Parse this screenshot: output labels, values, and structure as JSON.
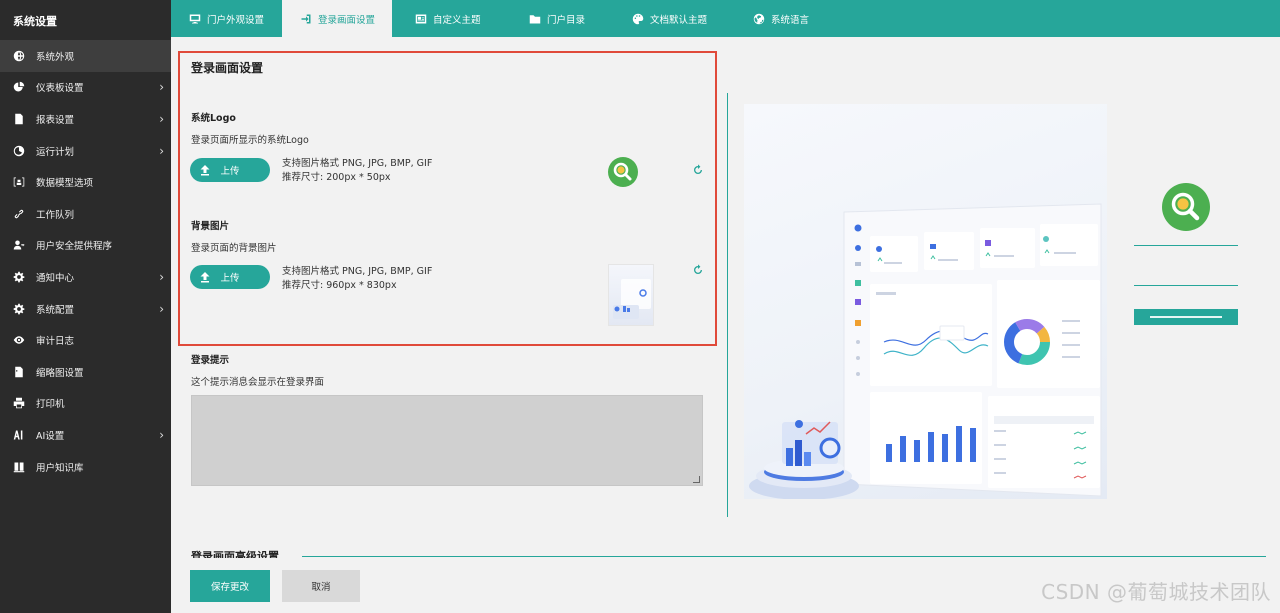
{
  "sidebar": {
    "title": "系统设置",
    "items": [
      {
        "label": "系统外观",
        "icon": "globe-icon",
        "active": true,
        "chevron": false
      },
      {
        "label": "仪表板设置",
        "icon": "pie-chart-icon",
        "chevron": true
      },
      {
        "label": "报表设置",
        "icon": "report-icon",
        "chevron": true
      },
      {
        "label": "运行计划",
        "icon": "clock-icon",
        "chevron": true
      },
      {
        "label": "数据模型选项",
        "icon": "data-model-icon",
        "chevron": false
      },
      {
        "label": "工作队列",
        "icon": "link-icon",
        "chevron": false
      },
      {
        "label": "用户安全提供程序",
        "icon": "user-key-icon",
        "chevron": false
      },
      {
        "label": "通知中心",
        "icon": "gear-icon",
        "chevron": true
      },
      {
        "label": "系统配置",
        "icon": "gear-icon",
        "chevron": true
      },
      {
        "label": "审计日志",
        "icon": "eye-icon",
        "chevron": false
      },
      {
        "label": "缩略图设置",
        "icon": "image-file-icon",
        "chevron": false
      },
      {
        "label": "打印机",
        "icon": "printer-icon",
        "chevron": false
      },
      {
        "label": "AI设置",
        "icon": "ai-icon",
        "chevron": true
      },
      {
        "label": "用户知识库",
        "icon": "book-icon",
        "chevron": false
      }
    ]
  },
  "tabs": [
    {
      "label": "门户外观设置",
      "icon": "monitor-icon",
      "active": false
    },
    {
      "label": "登录画面设置",
      "icon": "sign-in-icon",
      "active": true
    },
    {
      "label": "自定义主题",
      "icon": "id-card-icon",
      "active": false
    },
    {
      "label": "门户目录",
      "icon": "folder-icon",
      "active": false
    },
    {
      "label": "文档默认主题",
      "icon": "palette-icon",
      "active": false
    },
    {
      "label": "系统语言",
      "icon": "globe-icon",
      "active": false
    }
  ],
  "login_settings": {
    "title": "登录画面设置",
    "logo": {
      "title": "系统Logo",
      "desc": "登录页面所显示的系统Logo",
      "upload_label": "上传",
      "format_text": "支持图片格式 PNG, JPG, BMP, GIF",
      "size_text": "推荐尺寸: 200px * 50px"
    },
    "background": {
      "title": "背景图片",
      "desc": "登录页面的背景图片",
      "upload_label": "上传",
      "format_text": "支持图片格式 PNG, JPG, BMP, GIF",
      "size_text": "推荐尺寸: 960px * 830px"
    },
    "hint": {
      "title": "登录提示",
      "desc": "这个提示消息会显示在登录界面",
      "value": ""
    }
  },
  "advanced_title": "登录画面高级设置",
  "footer": {
    "save_label": "保存更改",
    "cancel_label": "取消"
  },
  "watermark": "CSDN @葡萄城技术团队",
  "colors": {
    "accent": "#26a69a",
    "sidebar_bg": "#2b2b2b",
    "highlight_border": "#e04a3a",
    "logo_green": "#4caf50"
  }
}
